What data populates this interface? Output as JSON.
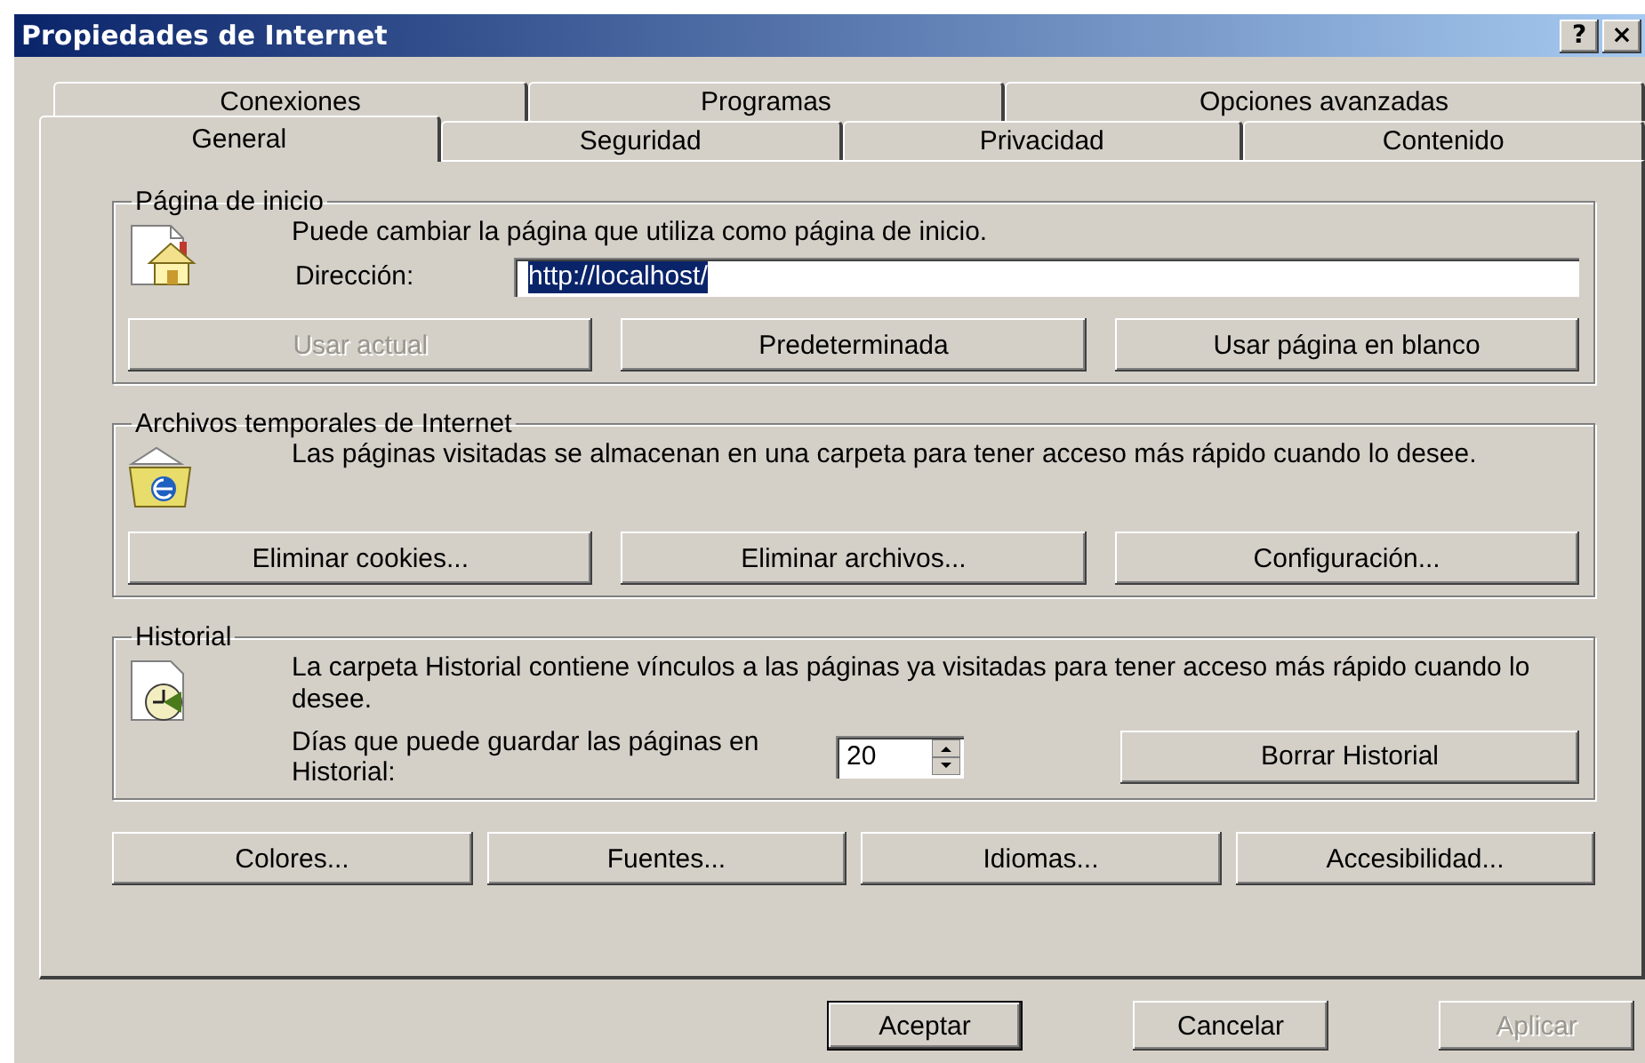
{
  "window": {
    "title": "Propiedades de Internet",
    "title_buttons": [
      "?",
      "×"
    ]
  },
  "tab_rows": [
    [
      {
        "label": "Conexiones",
        "selected": false
      },
      {
        "label": "Programas",
        "selected": false
      },
      {
        "label": "Opciones avanzadas",
        "selected": false
      }
    ],
    [
      {
        "label": "General",
        "selected": true
      },
      {
        "label": "Seguridad",
        "selected": false
      },
      {
        "label": "Privacidad",
        "selected": false
      },
      {
        "label": "Contenido",
        "selected": false
      }
    ]
  ],
  "home_page": {
    "title": "Página de inicio",
    "description": "Puede cambiar la página que utiliza como página de inicio.",
    "address_label": "Dirección:",
    "address_value": "http://localhost/",
    "value_highlighted": true,
    "buttons": [
      {
        "label": "Usar actual",
        "disabled": true
      },
      {
        "label": "Predeterminada",
        "disabled": false
      },
      {
        "label": "Usar página en blanco",
        "disabled": false
      }
    ]
  },
  "temp_files": {
    "title": "Archivos temporales de Internet",
    "description": "Las páginas visitadas se almacenan en una carpeta para tener acceso más rápido cuando lo desee.",
    "buttons": [
      {
        "label": "Eliminar cookies...",
        "disabled": false
      },
      {
        "label": "Eliminar archivos...",
        "disabled": false
      },
      {
        "label": "Configuración...",
        "disabled": false
      }
    ]
  },
  "history": {
    "title": "Historial",
    "description": "La carpeta Historial contiene vínculos a las páginas ya visitadas para tener acceso más rápido cuando lo desee.",
    "days_label": "Días que puede guardar las páginas en Historial:",
    "days_value": "20",
    "button": {
      "label": "Borrar Historial",
      "disabled": false
    }
  },
  "bottom_buttons": [
    {
      "label": "Colores...",
      "disabled": false
    },
    {
      "label": "Fuentes...",
      "disabled": false
    },
    {
      "label": "Idiomas...",
      "disabled": false
    },
    {
      "label": "Accesibilidad...",
      "disabled": false
    }
  ],
  "dialog_buttons": [
    {
      "label": "Aceptar",
      "disabled": false,
      "default": true
    },
    {
      "label": "Cancelar",
      "disabled": false,
      "default": false
    },
    {
      "label": "Aplicar",
      "disabled": true,
      "default": false
    }
  ]
}
